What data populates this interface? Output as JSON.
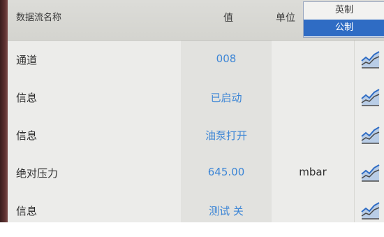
{
  "header": {
    "name_label": "数据流名称",
    "value_label": "值",
    "unit_label": "单位"
  },
  "unit_toggle": {
    "imperial_label": "英制",
    "metric_label": "公制",
    "selected": "公制"
  },
  "rows": [
    {
      "name": "通道",
      "value": "008",
      "unit": ""
    },
    {
      "name": "信息",
      "value": "已启动",
      "unit": ""
    },
    {
      "name": "信息",
      "value": "油泵打开",
      "unit": ""
    },
    {
      "name": "绝对压力",
      "value": "645.00",
      "unit": "mbar"
    },
    {
      "name": "信息",
      "value": "测试 关",
      "unit": ""
    }
  ],
  "icons": {
    "graph_button": "line-graph-icon"
  },
  "colors": {
    "value_text": "#3d86d6",
    "toggle_selected": "#2f6cc4"
  }
}
